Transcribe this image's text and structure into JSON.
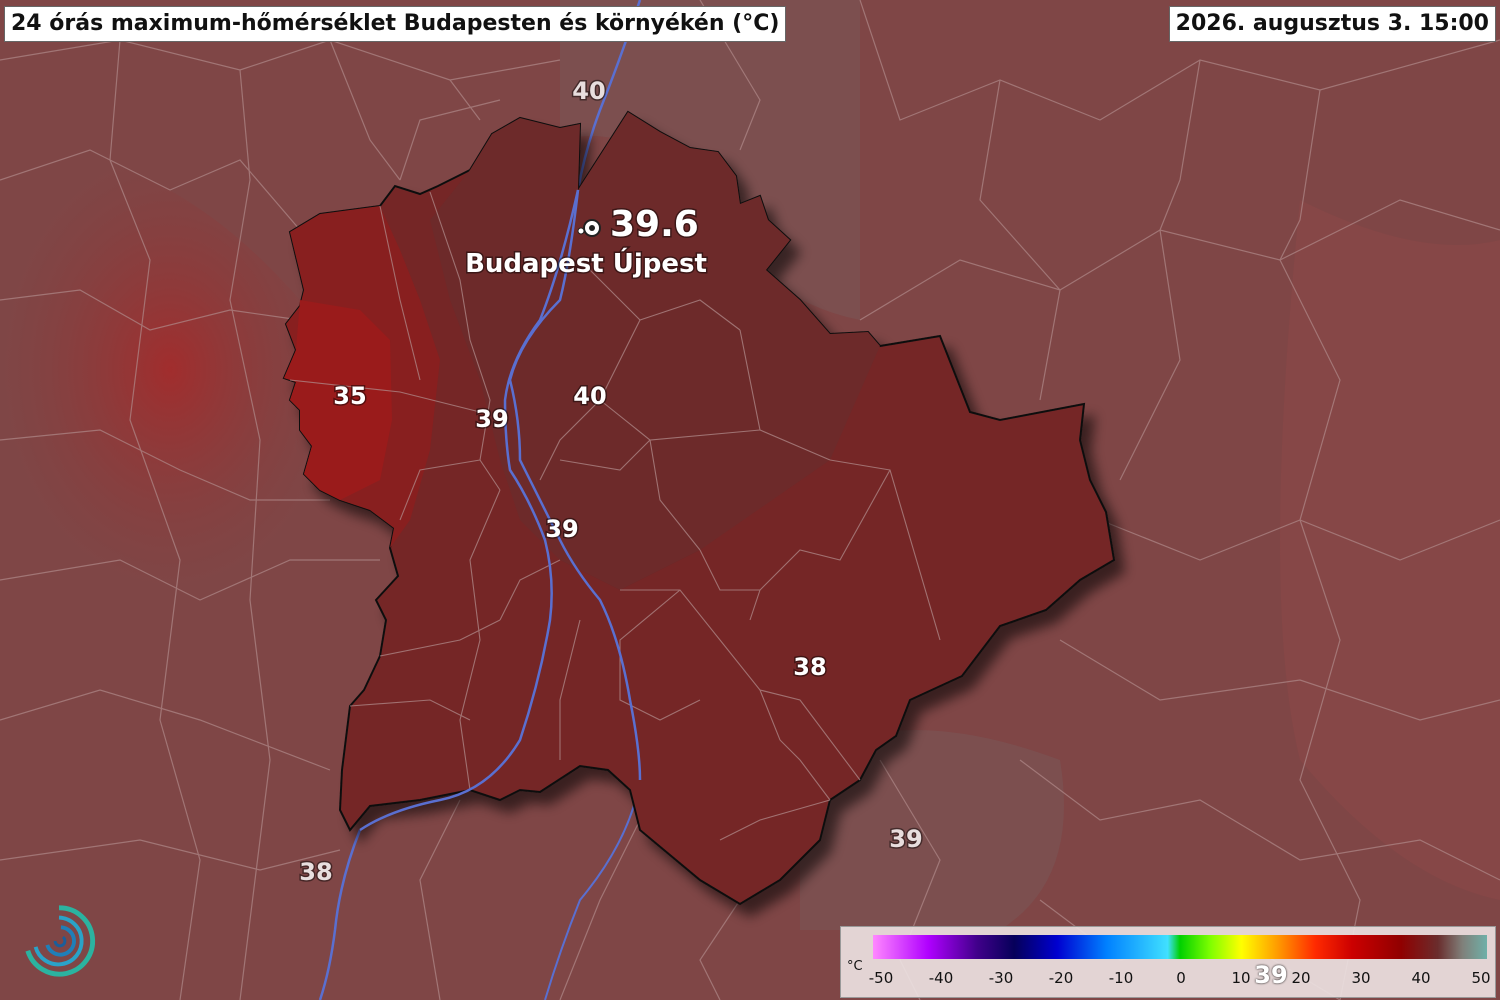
{
  "header": {
    "title": "24 órás maximum-hőmérséklet Budapesten és környékén (°C)",
    "timestamp": "2026. augusztus 3. 15:00"
  },
  "station": {
    "value": "39.6",
    "name": "Budapest Újpest"
  },
  "map_labels": {
    "north": "40",
    "west": "35",
    "buda_center": "39",
    "pest_center": "40",
    "center_south": "39",
    "southeast": "38",
    "outside_southeast": "39",
    "outside_southwest": "38"
  },
  "legend": {
    "unit": "°C",
    "ticks": [
      "-50",
      "-40",
      "-30",
      "-20",
      "-10",
      "0",
      "10",
      "20",
      "30",
      "40",
      "50"
    ],
    "marker": "39"
  },
  "colors": {
    "background": "#7f4646",
    "city_fill": "#742828",
    "west_hot": "#8e1f1f",
    "river": "#5a6fd0"
  },
  "icons": {
    "station": "camera-marker-icon",
    "logo": "swirl-logo-icon"
  }
}
